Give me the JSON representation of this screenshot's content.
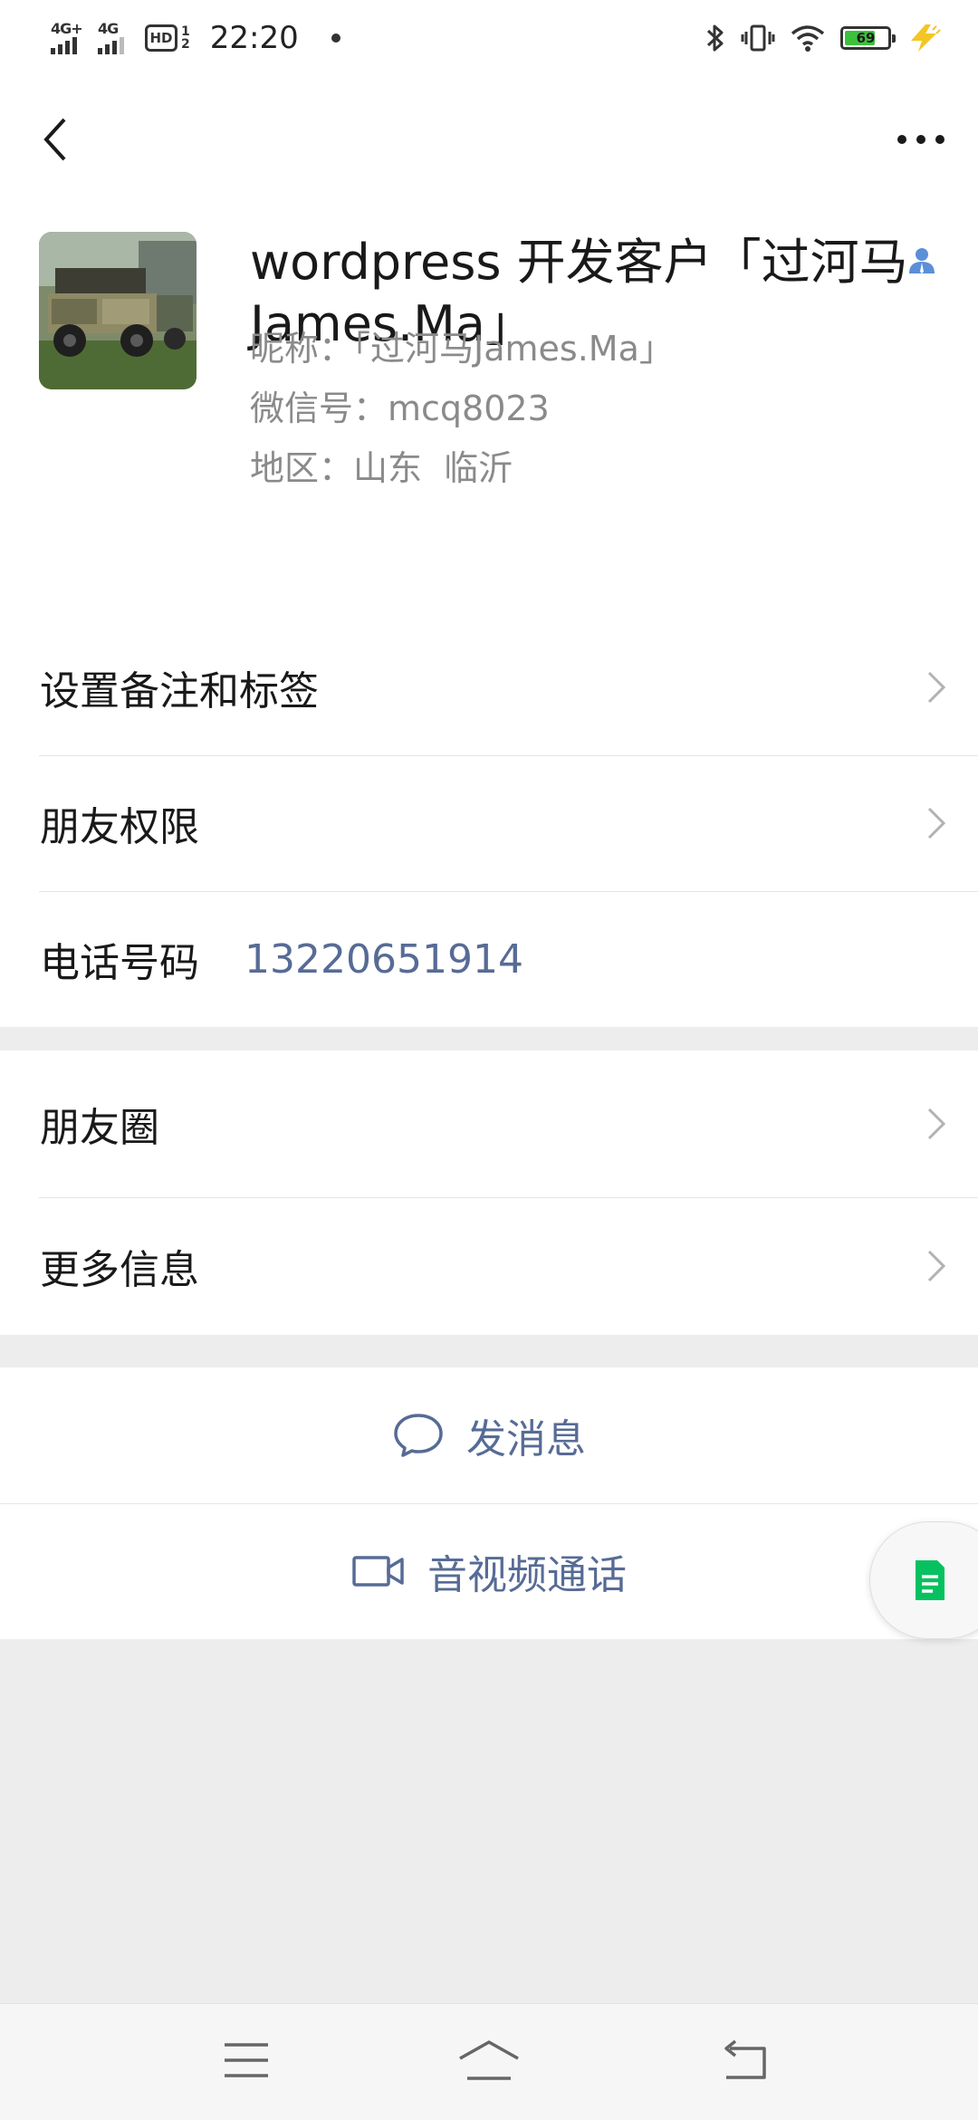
{
  "status_bar": {
    "network_1": "4G+",
    "network_2": "4G",
    "hd_label": "HD",
    "hd_sub": "1\n2",
    "time": "22:20",
    "battery_level": "69",
    "icons": [
      "bluetooth-icon",
      "vibrate-icon",
      "wifi-icon",
      "battery-icon",
      "charging-icon"
    ]
  },
  "header": {
    "back_icon": "chevron-left-icon",
    "more_icon": "more-dots-icon"
  },
  "profile": {
    "name": "wordpress 开发客户「过河马James.Ma」",
    "nickname_label": "昵称：",
    "nickname": "「过河马James.Ma」",
    "wechat_id_label": "微信号：",
    "wechat_id": "mcq8023",
    "region_label": "地区：",
    "region": "山东  临沂",
    "contact_badge_icon": "contact-person-icon"
  },
  "settings": {
    "remark_tags": "设置备注和标签",
    "friend_permissions": "朋友权限",
    "phone_label": "电话号码",
    "phone_number": "13220651914"
  },
  "more": {
    "moments": "朋友圈",
    "more_info": "更多信息"
  },
  "actions": {
    "send_message": "发消息",
    "video_call": "音视频通话"
  },
  "colors": {
    "link": "#576b95",
    "page_bg": "#ededed",
    "accent_green": "#07c160"
  },
  "nav_bar": {
    "icons": [
      "menu-icon",
      "home-icon",
      "back-icon"
    ]
  }
}
